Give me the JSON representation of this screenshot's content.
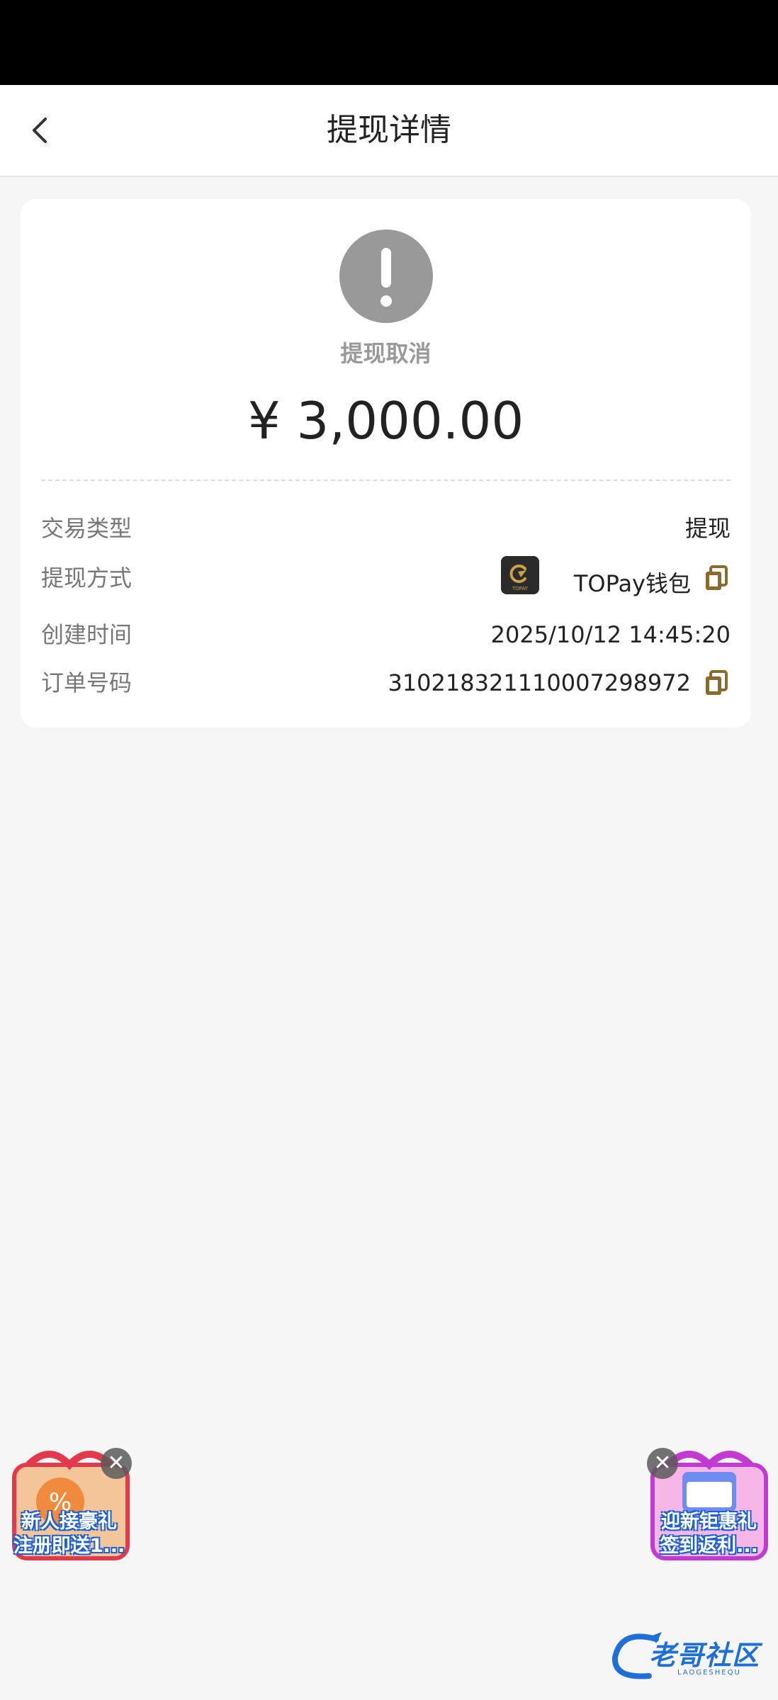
{
  "header": {
    "title": "提现详情"
  },
  "summary": {
    "status_text": "提现取消",
    "amount": "¥ 3,000.00"
  },
  "details": [
    {
      "label": "交易类型",
      "value": "提现"
    },
    {
      "label": "提现方式",
      "value": "TOPay钱包"
    },
    {
      "label": "创建时间",
      "value": "2025/10/12 14:45:20"
    },
    {
      "label": "订单号码",
      "value": "310218321110007298972"
    }
  ],
  "wallet_logo_text": "TOPAY",
  "banners": {
    "left": {
      "line1": "新人接豪礼",
      "line2": "注册即送1..."
    },
    "right": {
      "line1": "迎新钜惠礼",
      "line2": "签到返利..."
    }
  },
  "watermark": {
    "title": "老哥社区",
    "subtitle": "LAOGESHEQU"
  },
  "colors": {
    "status_gray": "#999999",
    "copy_icon": "#8b6a2e",
    "watermark_blue": "#1f6fd6"
  }
}
